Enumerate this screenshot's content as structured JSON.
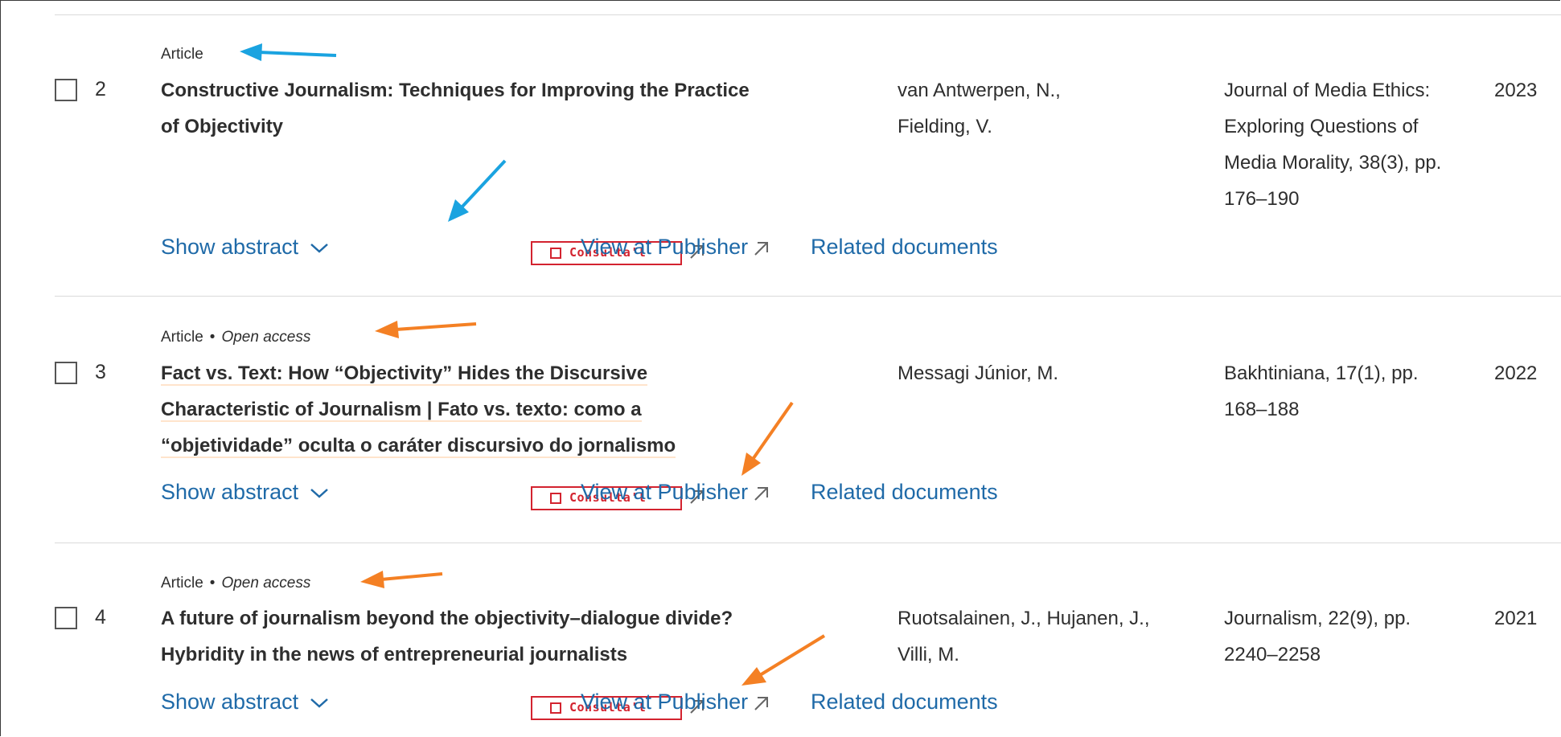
{
  "colors": {
    "link": "#1f6aa8",
    "consulta_red": "#d3232f",
    "annotation_blue": "#1aa3e0",
    "annotation_orange": "#f48024"
  },
  "results": [
    {
      "number": "2",
      "doc_type": "Article",
      "open_access": "",
      "title_lines": [
        "Constructive Journalism: Techniques for Improving the Practice",
        "of Objectivity"
      ],
      "authors_lines": [
        "van Antwerpen, N.,",
        "Fielding, V."
      ],
      "source_lines": [
        "Journal of Media Ethics:",
        "Exploring Questions of",
        "Media Morality, 38(3), pp.",
        "176–190"
      ],
      "year": "2023",
      "actions": {
        "show_abstract": "Show abstract",
        "consulta": "Consulta'l",
        "view_publisher": "View at Publisher",
        "related": "Related documents"
      }
    },
    {
      "number": "3",
      "doc_type": "Article",
      "open_access": "Open access",
      "title_lines": [
        "Fact vs. Text: How “Objectivity” Hides the Discursive",
        "Characteristic of Journalism | Fato vs. texto: como a",
        "“objetividade” oculta o caráter discursivo do jornalismo"
      ],
      "authors_lines": [
        "Messagi Júnior, M."
      ],
      "source_lines": [
        "Bakhtiniana, 17(1), pp.",
        "168–188"
      ],
      "year": "2022",
      "actions": {
        "show_abstract": "Show abstract",
        "consulta": "Consulta'l",
        "view_publisher": "View at Publisher",
        "related": "Related documents"
      }
    },
    {
      "number": "4",
      "doc_type": "Article",
      "open_access": "Open access",
      "title_lines": [
        "A future of journalism beyond the objectivity–dialogue divide?",
        "Hybridity in the news of entrepreneurial journalists"
      ],
      "authors_lines": [
        "Ruotsalainen, J., Hujanen, J.,",
        "Villi, M."
      ],
      "source_lines": [
        "Journalism, 22(9), pp.",
        "2240–2258"
      ],
      "year": "2021",
      "actions": {
        "show_abstract": "Show abstract",
        "consulta": "Consulta'l",
        "view_publisher": "View at Publisher",
        "related": "Related documents"
      }
    }
  ]
}
